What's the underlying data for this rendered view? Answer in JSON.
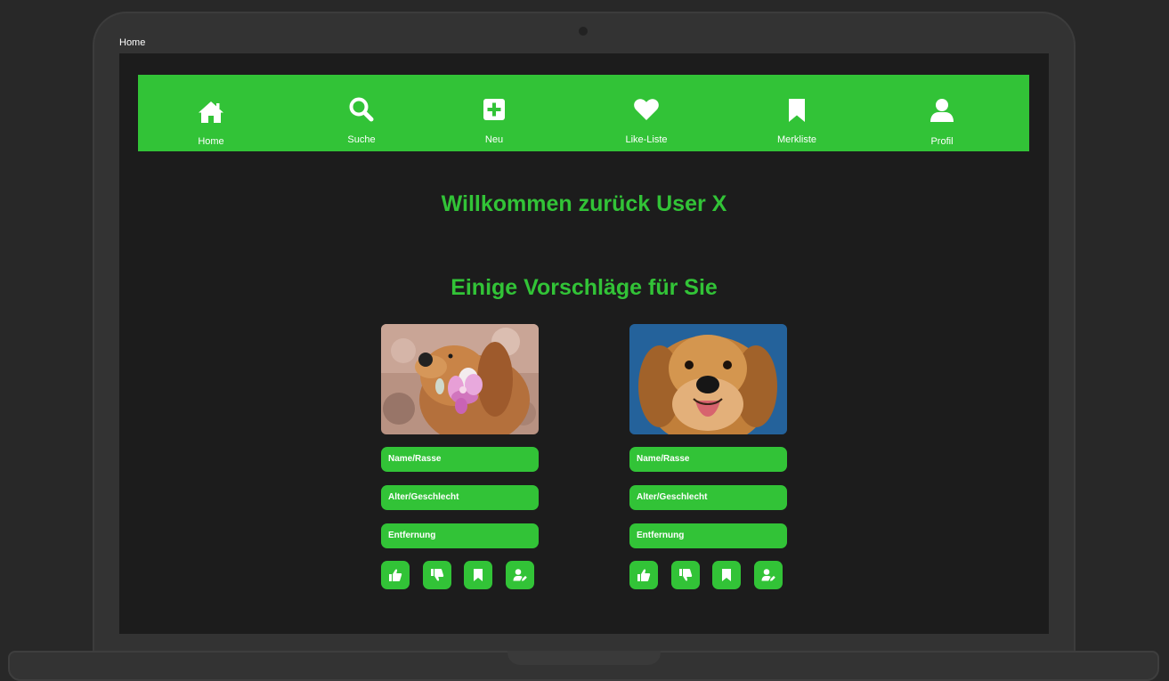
{
  "frame": {
    "label": "Home"
  },
  "colors": {
    "accent": "#32c337",
    "screen_bg": "#1c1c1c",
    "frame_bg": "#282828"
  },
  "nav": {
    "items": [
      {
        "label": "Home",
        "icon": "home-icon"
      },
      {
        "label": "Suche",
        "icon": "search-icon"
      },
      {
        "label": "Neu",
        "icon": "plus-square-icon"
      },
      {
        "label": "Like-Liste",
        "icon": "heart-icon"
      },
      {
        "label": "Merkliste",
        "icon": "bookmark-icon"
      },
      {
        "label": "Profil",
        "icon": "user-icon"
      }
    ]
  },
  "main": {
    "welcome": "Willkommen zurück User X",
    "suggestions_title": "Einige Vorschläge für Sie"
  },
  "cards": [
    {
      "image": "golden-retriever-with-flower",
      "name_field": "Name/Rasse",
      "age_field": "Alter/Geschlecht",
      "distance_field": "Entfernung",
      "actions": [
        "thumbs-up-icon",
        "thumbs-down-icon",
        "bookmark-icon",
        "user-edit-icon"
      ]
    },
    {
      "image": "golden-retriever-blue-background",
      "name_field": "Name/Rasse",
      "age_field": "Alter/Geschlecht",
      "distance_field": "Entfernung",
      "actions": [
        "thumbs-up-icon",
        "thumbs-down-icon",
        "bookmark-icon",
        "user-edit-icon"
      ]
    }
  ]
}
